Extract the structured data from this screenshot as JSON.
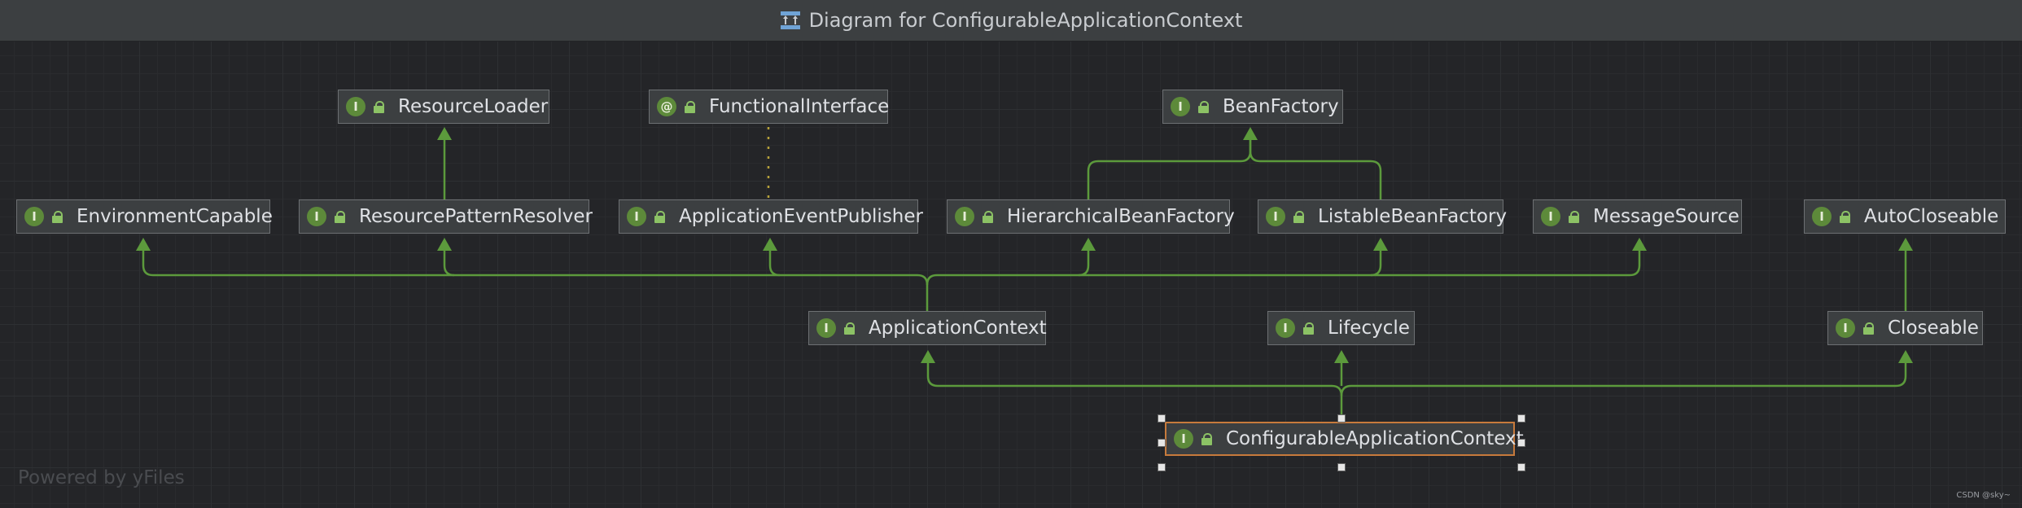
{
  "window": {
    "title": "Diagram for ConfigurableApplicationContext",
    "icon": "diagram-icon"
  },
  "colors": {
    "edge": "#5c9a3c",
    "badge": "#5d8a3a",
    "selected_border": "#c77a3c",
    "dashed_edge": "#b5a03a"
  },
  "nodes": {
    "resource_loader": {
      "badge": "I",
      "label": "ResourceLoader"
    },
    "functional_interface": {
      "badge": "@",
      "label": "FunctionalInterface"
    },
    "bean_factory": {
      "badge": "I",
      "label": "BeanFactory"
    },
    "environment_capable": {
      "badge": "I",
      "label": "EnvironmentCapable"
    },
    "resource_pattern_resolver": {
      "badge": "I",
      "label": "ResourcePatternResolver"
    },
    "application_event_publisher": {
      "badge": "I",
      "label": "ApplicationEventPublisher"
    },
    "hierarchical_bean_factory": {
      "badge": "I",
      "label": "HierarchicalBeanFactory"
    },
    "listable_bean_factory": {
      "badge": "I",
      "label": "ListableBeanFactory"
    },
    "message_source": {
      "badge": "I",
      "label": "MessageSource"
    },
    "auto_closeable": {
      "badge": "I",
      "label": "AutoCloseable"
    },
    "application_context": {
      "badge": "I",
      "label": "ApplicationContext"
    },
    "lifecycle": {
      "badge": "I",
      "label": "Lifecycle"
    },
    "closeable": {
      "badge": "I",
      "label": "Closeable"
    },
    "configurable_application_context": {
      "badge": "I",
      "label": "ConfigurableApplicationContext",
      "selected": true
    }
  },
  "footer": {
    "powered_by": "Powered by yFiles",
    "watermark": "CSDN @sky~"
  }
}
